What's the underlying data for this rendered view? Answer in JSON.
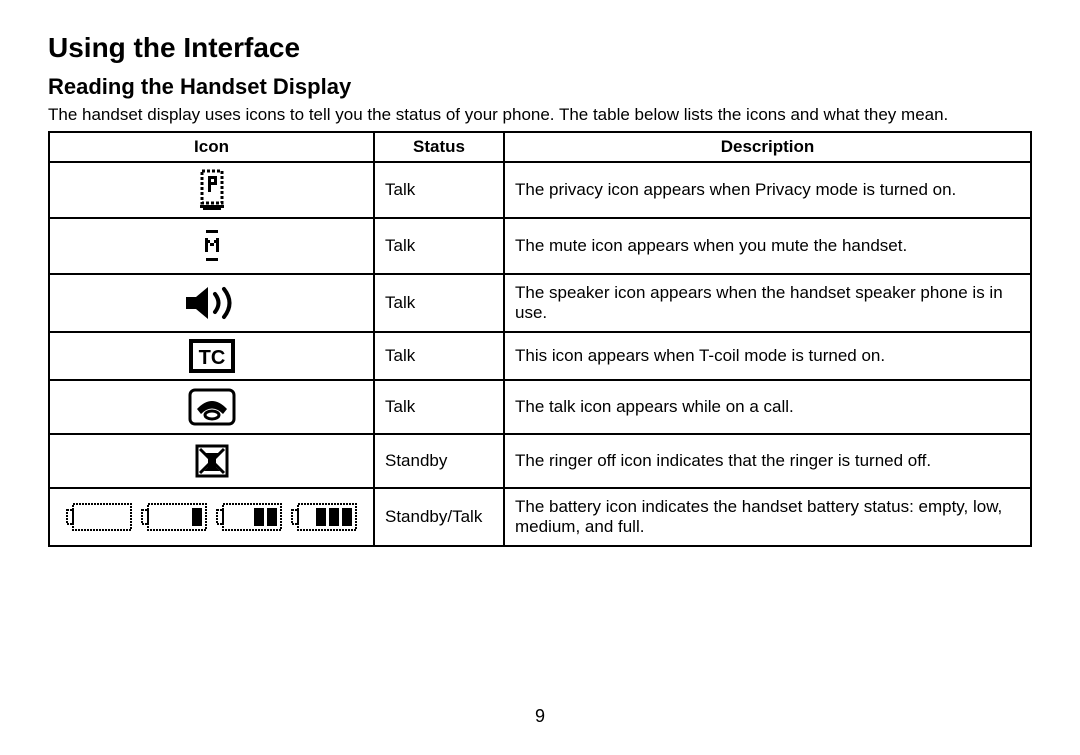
{
  "title": "Using the Interface",
  "subtitle": "Reading the Handset Display",
  "intro": "The handset display uses icons to tell you the status of your phone. The table below lists the icons and what they mean.",
  "headers": {
    "icon": "Icon",
    "status": "Status",
    "description": "Description"
  },
  "rows": [
    {
      "icon": "privacy",
      "status": "Talk",
      "description": "The privacy icon appears when Privacy mode is turned on."
    },
    {
      "icon": "mute",
      "status": "Talk",
      "description": "The mute icon appears when you mute the handset."
    },
    {
      "icon": "speaker",
      "status": "Talk",
      "description": "The speaker icon appears when the handset speaker phone is in use."
    },
    {
      "icon": "tcoil",
      "status": "Talk",
      "description": "This icon appears when T-coil mode is turned on."
    },
    {
      "icon": "talk",
      "status": "Talk",
      "description": "The talk icon appears while on a call."
    },
    {
      "icon": "ringer-off",
      "status": "Standby",
      "description": "The ringer off icon indicates that the ringer is turned off."
    },
    {
      "icon": "battery",
      "status": "Standby/Talk",
      "description": "The battery icon indicates the handset battery status: empty, low, medium, and full."
    }
  ],
  "page_number": "9"
}
